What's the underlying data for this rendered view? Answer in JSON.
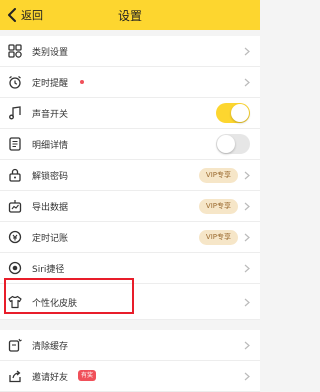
{
  "header": {
    "back_label": "返回",
    "title": "设置"
  },
  "items": [
    {
      "label": "类别设置",
      "icon": "category-grid-icon"
    },
    {
      "label": "定时提醒",
      "icon": "alarm-clock-icon",
      "dot": true
    },
    {
      "label": "声音开关",
      "icon": "music-note-icon",
      "toggle": true
    },
    {
      "label": "明细详情",
      "icon": "document-list-icon",
      "toggle": false
    },
    {
      "label": "解锁密码",
      "icon": "lock-icon",
      "tag": "VIP专享"
    },
    {
      "label": "导出数据",
      "icon": "export-icon",
      "tag": "VIP专享"
    },
    {
      "label": "定时记账",
      "icon": "scheduled-bookkeeping-icon",
      "tag": "VIP专享"
    },
    {
      "label": "Siri捷径",
      "icon": "siri-icon"
    },
    {
      "label": "个性化皮肤",
      "icon": "tshirt-icon"
    },
    {
      "label": "清除缓存",
      "icon": "clean-icon"
    },
    {
      "label": "邀请好友",
      "icon": "share-icon",
      "badge": "有奖"
    }
  ],
  "colors": {
    "accent": "#fdd62f",
    "highlight_box": "#e81d2a",
    "vip_bg": "#f6e6c8",
    "badge": "#f0505a"
  }
}
